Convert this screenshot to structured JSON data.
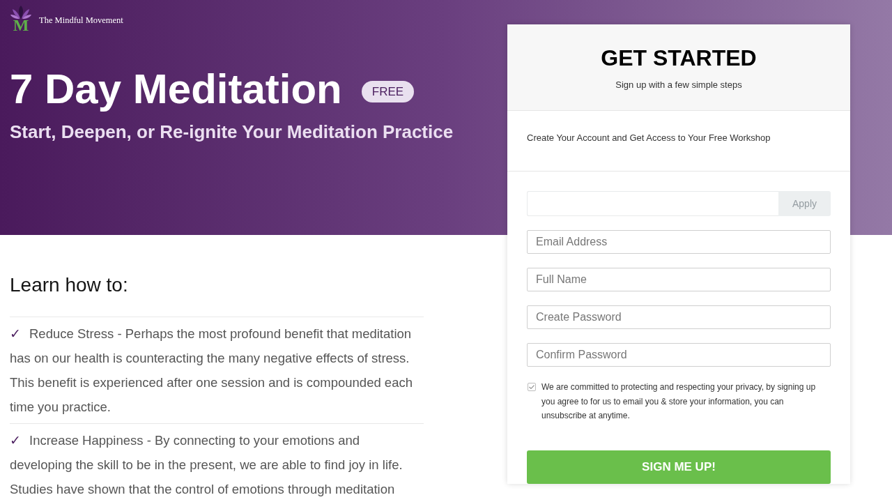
{
  "brand": {
    "mark": "M",
    "name": "The Mindful Movement"
  },
  "hero": {
    "title": "7 Day Meditation",
    "badge": "FREE",
    "subtitle": "Start, Deepen, or Re-ignite Your Meditation Practice"
  },
  "benefits": {
    "heading": "Learn how to:",
    "items": [
      {
        "mark": "✓",
        "text": "Reduce Stress - Perhaps the most profound benefit that meditation has on our health is counteracting the many negative effects of stress.  This benefit is experienced after one session and is compounded each time you practice."
      },
      {
        "mark": "✓",
        "text": "Increase Happiness - By connecting to your emotions and developing the skill to be in the present, we are able to find joy in life. Studies have shown that the control of emotions through meditation"
      }
    ]
  },
  "signup": {
    "title": "GET STARTED",
    "subtitle": "Sign up with a few simple steps",
    "intro": "Create Your Account and Get Access to Your Free Workshop",
    "coupon": {
      "button": "Apply",
      "disabled": true
    },
    "fields": [
      {
        "placeholder": "Email Address"
      },
      {
        "placeholder": "Full Name"
      },
      {
        "placeholder": "Create Password"
      },
      {
        "placeholder": "Confirm Password"
      }
    ],
    "consent": {
      "checked": true,
      "text": "We are committed to protecting and respecting your privacy, by signing up you agree to for us to email you & store your information, you can unsubscribe at anytime."
    },
    "submit": "SIGN ME UP!"
  }
}
